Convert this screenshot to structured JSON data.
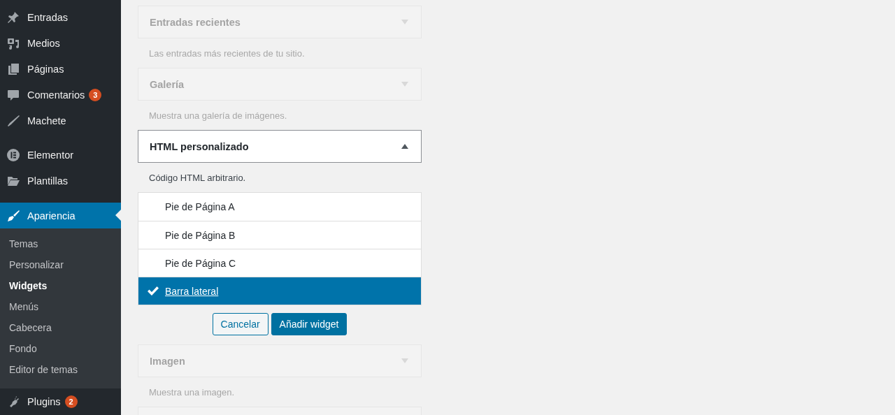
{
  "admin_menu": {
    "groups": [
      [
        {
          "label": "Entradas",
          "selected": false
        },
        {
          "label": "Medios",
          "selected": false
        },
        {
          "label": "Páginas",
          "selected": false
        },
        {
          "label": "Comentarios",
          "badge": "3",
          "selected": false
        },
        {
          "label": "Machete",
          "selected": false
        }
      ],
      [
        {
          "label": "Elementor",
          "selected": false
        },
        {
          "label": "Plantillas",
          "selected": false
        },
        {
          "label": "Apariencia",
          "selected": true,
          "children": [
            {
              "label": "Temas",
              "selected": false
            },
            {
              "label": "Personalizar",
              "selected": false
            },
            {
              "label": "Widgets",
              "selected": true
            },
            {
              "label": "Menús",
              "selected": false
            },
            {
              "label": "Cabecera",
              "selected": false
            },
            {
              "label": "Fondo",
              "selected": false
            },
            {
              "label": "Editor de temas",
              "selected": false
            }
          ]
        },
        {
          "label": "Plugins",
          "badge": "2",
          "selected": false
        }
      ]
    ]
  },
  "widgets": [
    {
      "title": "Entradas recientes",
      "description": "Las entradas más recientes de tu sitio.",
      "expanded": false
    },
    {
      "title": "Galería",
      "description": "Muestra una galería de imágenes.",
      "expanded": false
    },
    {
      "title": "HTML personalizado",
      "description": "Código HTML arbitrario.",
      "expanded": true,
      "sidebars": [
        {
          "label": "Pie de Página A",
          "selected": false
        },
        {
          "label": "Pie de Página B",
          "selected": false
        },
        {
          "label": "Pie de Página C",
          "selected": false
        },
        {
          "label": "Barra lateral",
          "selected": true
        }
      ],
      "buttons": [
        {
          "label": "Cancelar",
          "kind": "secondary"
        },
        {
          "label": "Añadir widget",
          "kind": "primary"
        }
      ]
    },
    {
      "title": "Imagen",
      "description": "Muestra una imagen.",
      "expanded": false
    }
  ]
}
